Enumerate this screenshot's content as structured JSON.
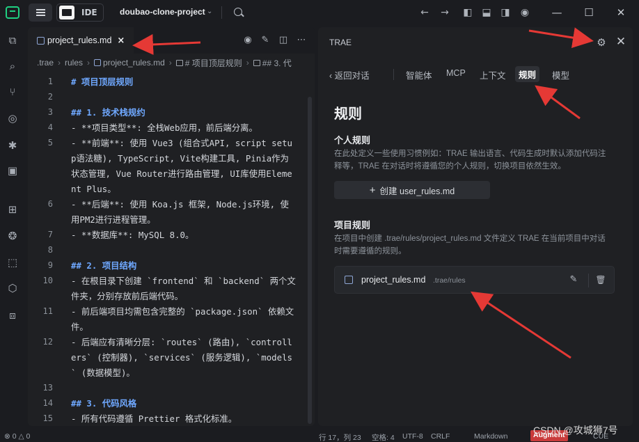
{
  "titlebar": {
    "mode_label": "IDE",
    "project_name": "doubao-clone-project"
  },
  "editor": {
    "tab_label": "project_rules.md",
    "tab_close": "×",
    "breadcrumb": [
      ".trae",
      "rules",
      "project_rules.md",
      "# 项目顶层规则",
      "## 3. 代"
    ],
    "lines": [
      {
        "n": "1",
        "text": "# 项目顶层规则",
        "kind": "heading"
      },
      {
        "n": "2",
        "text": "",
        "kind": "plain"
      },
      {
        "n": "3",
        "text": "## 1. 技术栈规约",
        "kind": "heading"
      },
      {
        "n": "4",
        "text": "- **项目类型**: 全栈Web应用，前后端分离。",
        "kind": "plain"
      },
      {
        "n": "5",
        "text": "- **前端**: 使用 Vue3 (组合式API, script setup语法糖), TypeScript, Vite构建工具, Pinia作为状态管理, Vue Router进行路由管理, UI库使用Element Plus。",
        "kind": "plain"
      },
      {
        "n": "6",
        "text": "- **后端**: 使用 Koa.js 框架, Node.js环境, 使用PM2进行进程管理。",
        "kind": "plain"
      },
      {
        "n": "7",
        "text": "- **数据库**: MySQL 8.0。",
        "kind": "plain"
      },
      {
        "n": "8",
        "text": "",
        "kind": "plain"
      },
      {
        "n": "9",
        "text": "## 2. 项目结构",
        "kind": "heading"
      },
      {
        "n": "10",
        "text": "- 在根目录下创建 `frontend` 和 `backend` 两个文件夹，分别存放前后端代码。",
        "kind": "plain"
      },
      {
        "n": "11",
        "text": "- 前后端项目均需包含完整的 `package.json` 依赖文件。",
        "kind": "plain"
      },
      {
        "n": "12",
        "text": "- 后端应有清晰分层: `routes` (路由), `controllers` (控制器), `services` (服务逻辑), `models` (数据模型)。",
        "kind": "plain"
      },
      {
        "n": "13",
        "text": "",
        "kind": "plain"
      },
      {
        "n": "14",
        "text": "## 3. 代码风格",
        "kind": "heading"
      },
      {
        "n": "15",
        "text": "- 所有代码遵循 Prettier 格式化标准。",
        "kind": "plain"
      }
    ]
  },
  "panel": {
    "title": "TRAE",
    "back_label": "返回对话",
    "tabs": [
      "智能体",
      "MCP",
      "上下文",
      "规则",
      "模型"
    ],
    "active_tab": "规则",
    "section_title": "规则",
    "personal": {
      "heading": "个人规则",
      "desc": "在此处定义一些使用习惯例如：TRAE 输出语言、代码生成时默认添加代码注释等，TRAE 在对话时将遵循您的个人规则，切换项目依然生效。",
      "create_label": "创建 user_rules.md"
    },
    "project": {
      "heading": "项目规则",
      "desc": "在项目中创建 .trae/rules/project_rules.md 文件定义 TRAE 在当前项目中对话时需要遵循的规则。",
      "file_name": "project_rules.md",
      "file_path": ".trae/rules"
    }
  },
  "statusbar": {
    "errors": "0",
    "warnings": "0",
    "position": "行 17，列 23",
    "indent": "空格: 4",
    "encoding": "UTF-8",
    "eol": "CRLF",
    "language": "Markdown",
    "augment": "Augment",
    "cue": "CUE"
  },
  "watermark": "CSDN @攻城狮7号",
  "colors": {
    "accent_green": "#1fd082",
    "arrow_red": "#e53935",
    "heading_blue": "#6fa8ff",
    "inline_code": "#7fd0a0"
  }
}
